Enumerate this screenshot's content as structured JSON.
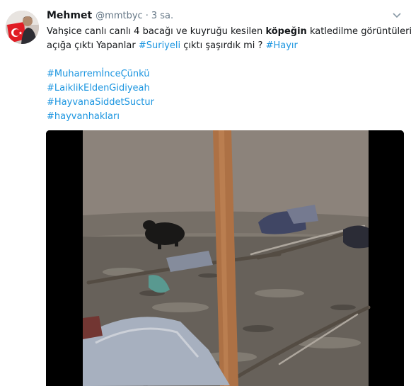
{
  "tweet": {
    "author": {
      "name": "Mehmet",
      "handle": "@mmtbyc",
      "separator": "·",
      "time": "3 sa."
    },
    "lines": {
      "l1_a": "Vahşice canlı canlı 4 bacağı ve kuyruğu kesilen ",
      "l1_b": "köpeğin",
      "l1_c": " katledilme görüntüleri",
      "l2_a": "açığa çıktı Yapanlar ",
      "l2_h1": "#Suriyeli",
      "l2_b": " çıktı şaşırdık mi ? ",
      "l2_h2": "#Hayır"
    },
    "hashtags": [
      "#MuharremİnceÇünkü",
      "#LaiklikEldenGidiyeah",
      "#HayvanaSiddetSuctur",
      "#hayvanhakları"
    ],
    "icons": {
      "avatar": "profile-photo-with-turkish-flag",
      "menu": "chevron-down-icon"
    },
    "colors": {
      "link": "#1b95e0",
      "text": "#14171a",
      "muted": "#657786"
    }
  }
}
